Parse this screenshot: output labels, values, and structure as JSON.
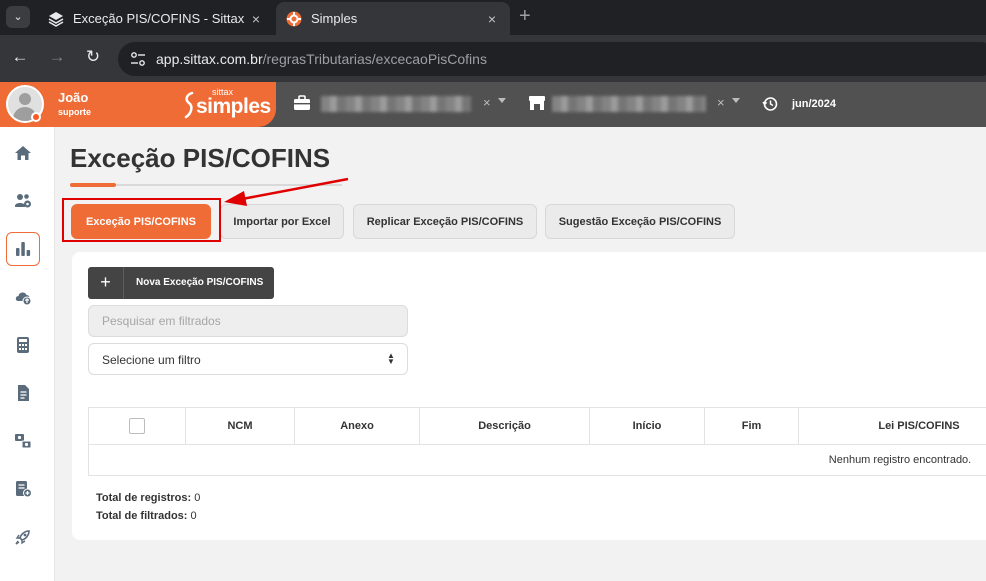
{
  "browser": {
    "tabs": [
      {
        "title": "Exceção PIS/COFINS - Sittax Bas",
        "active": false
      },
      {
        "title": "Simples",
        "active": true
      }
    ],
    "url_host": "app.sittax.com.br",
    "url_path": "/regrasTributarias/excecaoPisCofins",
    "tab_close": "×",
    "new_tab": "+",
    "menu": "⌄"
  },
  "header": {
    "user_name": "João",
    "user_role": "suporte",
    "logo_small": "sittax",
    "logo_big": "simples",
    "company_clear": "×",
    "establishment_clear": "×",
    "period": "jun/2024"
  },
  "page": {
    "title": "Exceção PIS/COFINS"
  },
  "tabs": [
    {
      "label": "Exceção PIS/COFINS",
      "active": true
    },
    {
      "label": "Importar por Excel",
      "active": false
    },
    {
      "label": "Replicar Exceção PIS/COFINS",
      "active": false
    },
    {
      "label": "Sugestão Exceção PIS/COFINS",
      "active": false
    }
  ],
  "toolbar": {
    "new_icon": "+",
    "new_label": "Nova Exceção PIS/COFINS",
    "search_placeholder": "Pesquisar em filtrados",
    "filter_value": "Selecione um filtro"
  },
  "table": {
    "columns": [
      "NCM",
      "Anexo",
      "Descrição",
      "Início",
      "Fim",
      "Lei PIS/COFINS"
    ],
    "empty_message": "Nenhum registro encontrado."
  },
  "totals": {
    "records_label": "Total de registros:",
    "records_value": "0",
    "filtered_label": "Total de filtrados:",
    "filtered_value": "0"
  },
  "colors": {
    "accent": "#ef6c36",
    "header_bg": "#515151",
    "annotation_red": "#e00000"
  }
}
